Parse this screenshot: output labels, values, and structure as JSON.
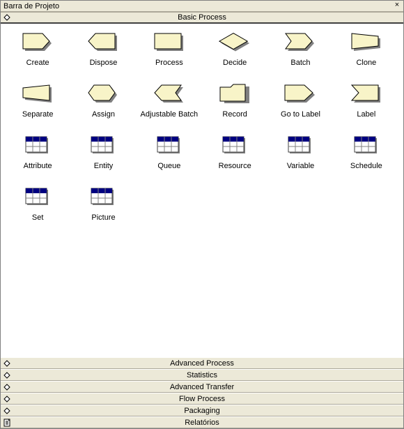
{
  "window": {
    "title": "Barra de Projeto",
    "close_glyph": "×"
  },
  "panels": {
    "open": {
      "title": "Basic Process"
    },
    "collapsed": [
      {
        "title": "Advanced Process",
        "icon": "diamond"
      },
      {
        "title": "Statistics",
        "icon": "diamond"
      },
      {
        "title": "Advanced Transfer",
        "icon": "diamond"
      },
      {
        "title": "Flow Process",
        "icon": "diamond"
      },
      {
        "title": "Packaging",
        "icon": "diamond"
      },
      {
        "title": "Relatórios",
        "icon": "report"
      }
    ]
  },
  "items": [
    {
      "label": "Create",
      "shape": "create"
    },
    {
      "label": "Dispose",
      "shape": "dispose"
    },
    {
      "label": "Process",
      "shape": "process"
    },
    {
      "label": "Decide",
      "shape": "decide"
    },
    {
      "label": "Batch",
      "shape": "batch"
    },
    {
      "label": "Clone",
      "shape": "clone"
    },
    {
      "label": "Separate",
      "shape": "separate"
    },
    {
      "label": "Assign",
      "shape": "assign"
    },
    {
      "label": "Adjustable Batch",
      "shape": "adjbatch"
    },
    {
      "label": "Record",
      "shape": "record"
    },
    {
      "label": "Go to Label",
      "shape": "goto"
    },
    {
      "label": "Label",
      "shape": "label"
    },
    {
      "label": "Attribute",
      "shape": "table"
    },
    {
      "label": "Entity",
      "shape": "table"
    },
    {
      "label": "Queue",
      "shape": "table"
    },
    {
      "label": "Resource",
      "shape": "table"
    },
    {
      "label": "Variable",
      "shape": "table"
    },
    {
      "label": "Schedule",
      "shape": "table"
    },
    {
      "label": "Set",
      "shape": "table"
    },
    {
      "label": "Picture",
      "shape": "table"
    }
  ],
  "colors": {
    "fill": "#f8f4c8",
    "stroke": "#000000",
    "shadow": "#808080",
    "tableHeader": "#000080",
    "tableBody": "#ffffff"
  }
}
